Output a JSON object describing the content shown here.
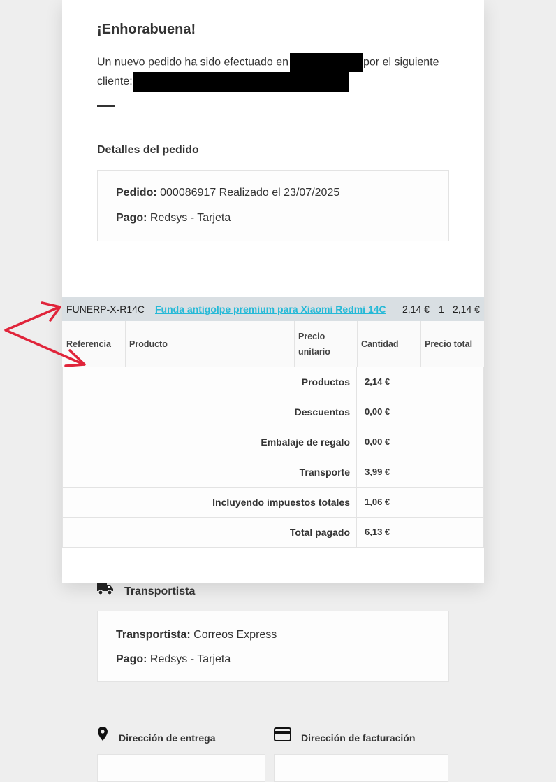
{
  "greeting": {
    "title": "¡Enhorabuena!",
    "text_part1": "Un nuevo pedido ha sido efectuado en",
    "text_part2": "por el siguiente",
    "text_part3": "cliente:"
  },
  "order_details": {
    "title": "Detalles del pedido",
    "order_label": "Pedido:",
    "order_value": "000086917 Realizado el 23/07/2025",
    "payment_label": "Pago:",
    "payment_value": "Redsys - Tarjeta"
  },
  "product_row": {
    "reference": "FUNERP-X-R14C",
    "name": "Funda antigolpe premium para Xiaomi Redmi 14C",
    "unit_price": "2,14 €",
    "quantity": "1",
    "total_price": "2,14 €"
  },
  "table_headers": {
    "reference": "Referencia",
    "product": "Producto",
    "unit_price_line1": "Precio",
    "unit_price_line2": "unitario",
    "quantity": "Cantidad",
    "total_price": "Precio total"
  },
  "totals": [
    {
      "label": "Productos",
      "value": "2,14 €"
    },
    {
      "label": "Descuentos",
      "value": "0,00 €"
    },
    {
      "label": "Embalaje de regalo",
      "value": "0,00 €"
    },
    {
      "label": "Transporte",
      "value": "3,99 €"
    },
    {
      "label": "Incluyendo impuestos totales",
      "value": "1,06 €"
    },
    {
      "label": "Total pagado",
      "value": "6,13 €"
    }
  ],
  "carrier": {
    "title": "Transportista",
    "icon": "truck-icon",
    "carrier_label": "Transportista:",
    "carrier_value": "Correos Express",
    "payment_label": "Pago:",
    "payment_value": "Redsys - Tarjeta"
  },
  "addresses": {
    "delivery_title": "Dirección de entrega",
    "delivery_icon": "location-pin-icon",
    "billing_title": "Dirección de facturación",
    "billing_icon": "credit-card-icon"
  },
  "colors": {
    "link": "#25b9d7",
    "arrow": "#e0243a",
    "product_bar": "#d9dfe3"
  }
}
